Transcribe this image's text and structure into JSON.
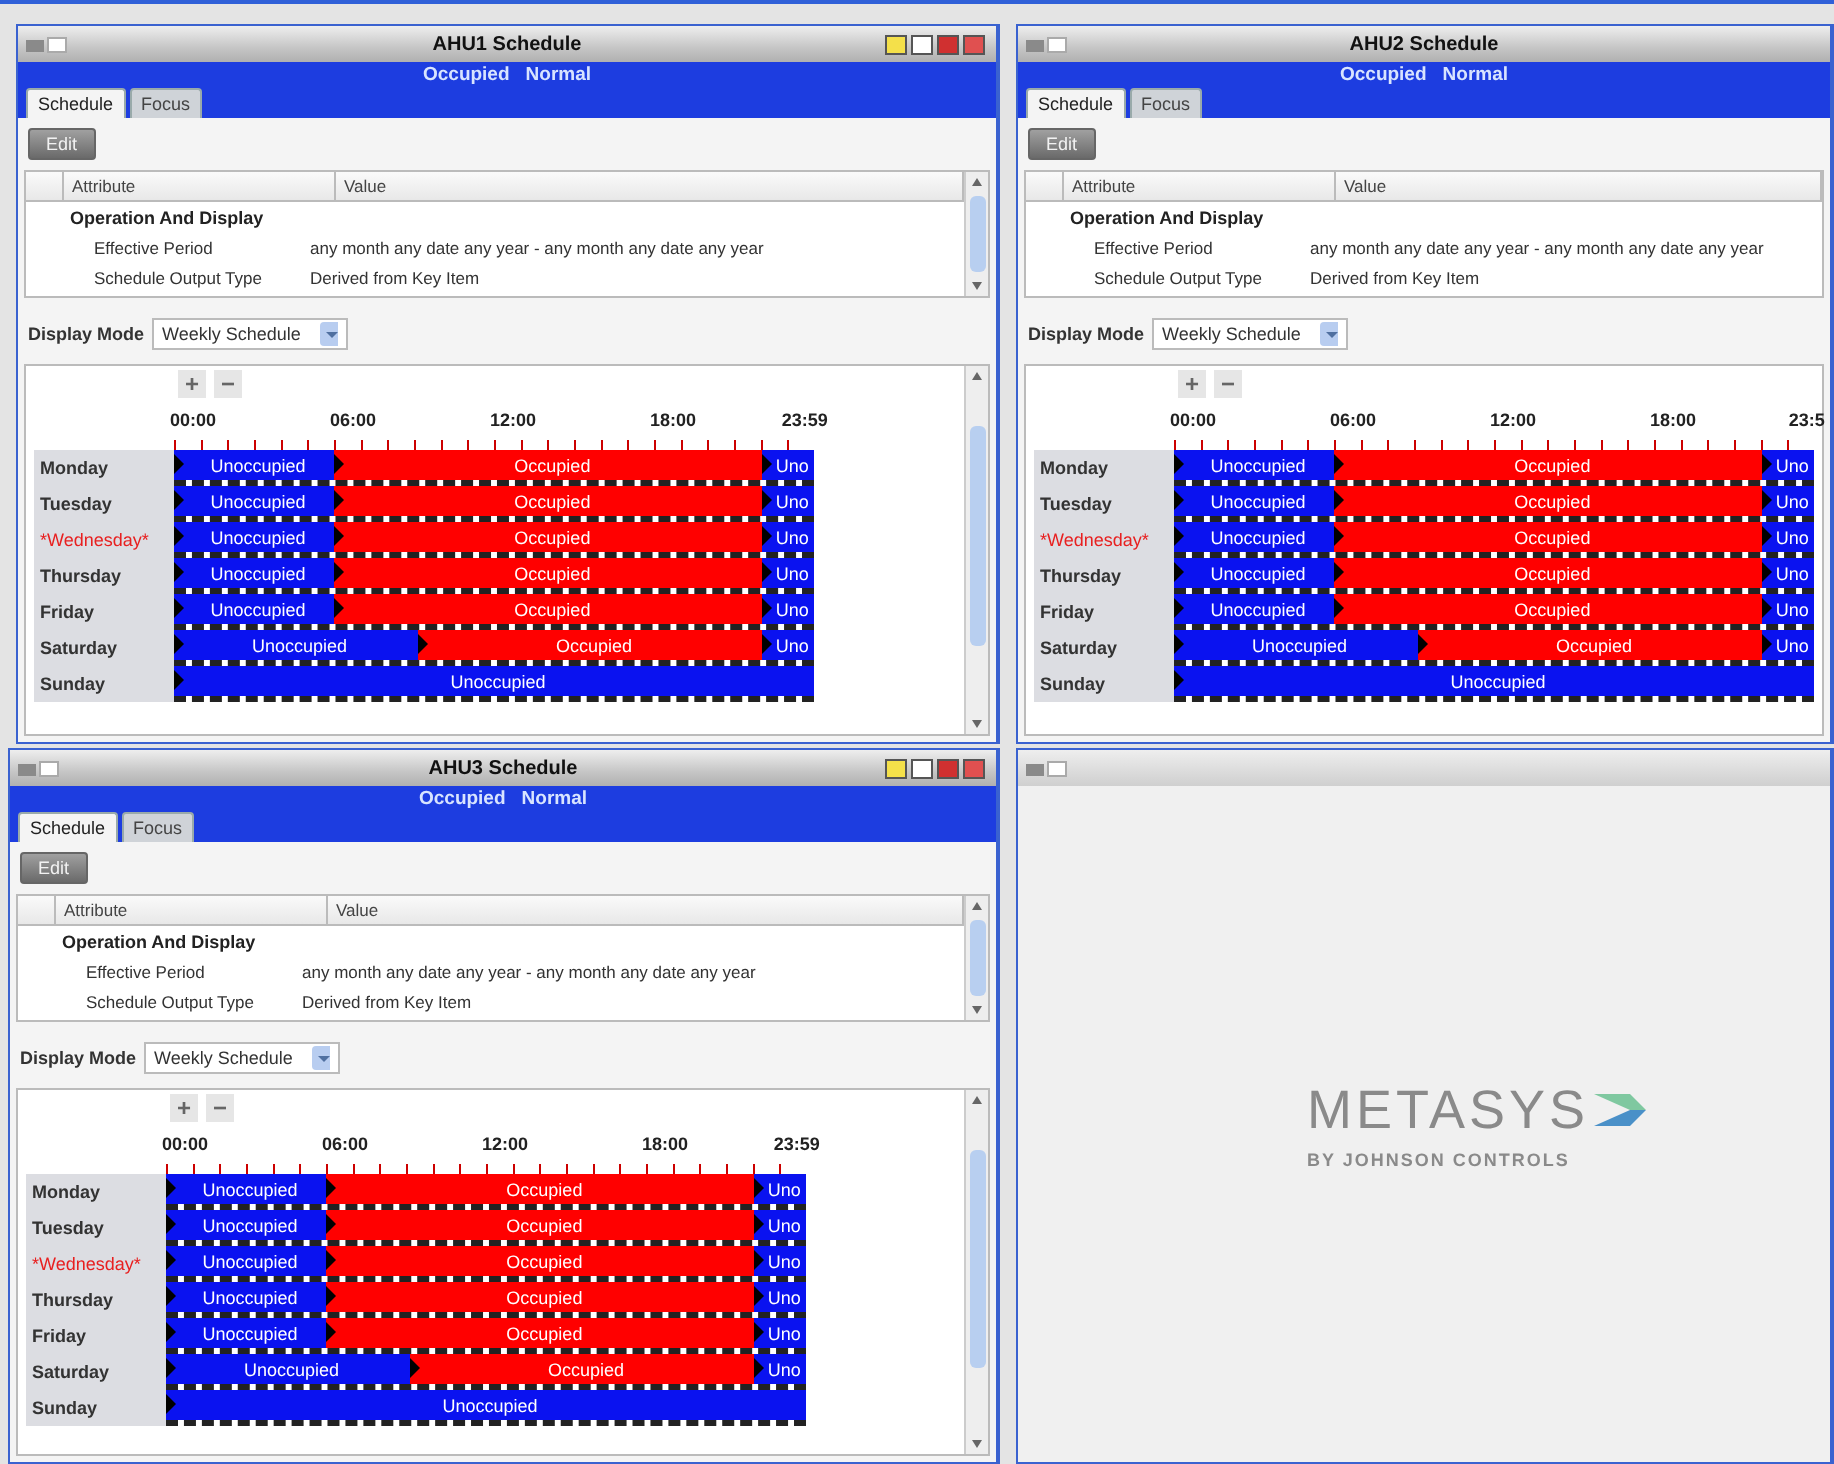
{
  "panels": [
    {
      "title": "AHU1 Schedule",
      "right_edge_hidden": false,
      "status": [
        "Occupied",
        "Normal"
      ],
      "tabs": [
        {
          "label": "Schedule",
          "selected": true
        },
        {
          "label": "Focus",
          "selected": false
        }
      ],
      "edit_button": {
        "label": "Edit",
        "disabled": true
      },
      "attributes": {
        "columns": [
          "Attribute",
          "Value"
        ],
        "group": "Operation And Display",
        "rows": [
          {
            "attribute": "Effective Period",
            "value": "any month any date any year  -  any month any date any year"
          },
          {
            "attribute": "Schedule Output Type",
            "value": "Derived from Key Item"
          }
        ]
      },
      "display_mode": {
        "label": "Display Mode",
        "value": "Weekly Schedule"
      },
      "schedule": {
        "zoom_in": "+",
        "zoom_out": "−",
        "times": [
          "00:00",
          "06:00",
          "12:00",
          "18:00",
          "23:59"
        ],
        "days": [
          {
            "name": "Monday",
            "today": false,
            "segments": [
              {
                "kind": "unoccupied",
                "label": "Unoccupied"
              },
              {
                "kind": "occupied",
                "label": "Occupied"
              },
              {
                "kind": "unoccupied",
                "label": "Uno"
              }
            ]
          },
          {
            "name": "Tuesday",
            "today": false,
            "segments": [
              {
                "kind": "unoccupied",
                "label": "Unoccupied"
              },
              {
                "kind": "occupied",
                "label": "Occupied"
              },
              {
                "kind": "unoccupied",
                "label": "Uno"
              }
            ]
          },
          {
            "name": "*Wednesday*",
            "today": true,
            "segments": [
              {
                "kind": "unoccupied",
                "label": "Unoccupied"
              },
              {
                "kind": "occupied",
                "label": "Occupied"
              },
              {
                "kind": "unoccupied",
                "label": "Uno"
              }
            ]
          },
          {
            "name": "Thursday",
            "today": false,
            "segments": [
              {
                "kind": "unoccupied",
                "label": "Unoccupied"
              },
              {
                "kind": "occupied",
                "label": "Occupied"
              },
              {
                "kind": "unoccupied",
                "label": "Uno"
              }
            ]
          },
          {
            "name": "Friday",
            "today": false,
            "segments": [
              {
                "kind": "unoccupied",
                "label": "Unoccupied"
              },
              {
                "kind": "occupied",
                "label": "Occupied"
              },
              {
                "kind": "unoccupied",
                "label": "Uno"
              }
            ]
          },
          {
            "name": "Saturday",
            "today": false,
            "segments": [
              {
                "kind": "unoccupied",
                "label": "Unoccupied"
              },
              {
                "kind": "occupied",
                "label": "Occupied"
              },
              {
                "kind": "unoccupied",
                "label": "Uno"
              }
            ]
          },
          {
            "name": "Sunday",
            "today": false,
            "segments": [
              {
                "kind": "unoccupied",
                "label": "Unoccupied"
              }
            ]
          }
        ]
      }
    },
    {
      "title": "AHU2 Schedule",
      "right_edge_hidden": true,
      "status": [
        "Occupied",
        "Normal"
      ],
      "tabs": [
        {
          "label": "Schedule",
          "selected": true
        },
        {
          "label": "Focus",
          "selected": false
        }
      ],
      "edit_button": {
        "label": "Edit",
        "disabled": true
      },
      "attributes": {
        "columns": [
          "Attribute",
          "Value"
        ],
        "group": "Operation And Display",
        "rows": [
          {
            "attribute": "Effective Period",
            "value": "any month any date any year  -  any month any date any year"
          },
          {
            "attribute": "Schedule Output Type",
            "value": "Derived from Key Item"
          }
        ]
      },
      "display_mode": {
        "label": "Display Mode",
        "value": "Weekly Schedule"
      },
      "schedule": {
        "zoom_in": "+",
        "zoom_out": "−",
        "times": [
          "00:00",
          "06:00",
          "12:00",
          "18:00",
          "23:5"
        ],
        "days": [
          {
            "name": "Monday",
            "today": false,
            "segments": [
              {
                "kind": "unoccupied",
                "label": "Unoccupied"
              },
              {
                "kind": "occupied",
                "label": "Occupied"
              },
              {
                "kind": "unoccupied",
                "label": "Uno"
              }
            ]
          },
          {
            "name": "Tuesday",
            "today": false,
            "segments": [
              {
                "kind": "unoccupied",
                "label": "Unoccupied"
              },
              {
                "kind": "occupied",
                "label": "Occupied"
              },
              {
                "kind": "unoccupied",
                "label": "Uno"
              }
            ]
          },
          {
            "name": "*Wednesday*",
            "today": true,
            "segments": [
              {
                "kind": "unoccupied",
                "label": "Unoccupied"
              },
              {
                "kind": "occupied",
                "label": "Occupied"
              },
              {
                "kind": "unoccupied",
                "label": "Uno"
              }
            ]
          },
          {
            "name": "Thursday",
            "today": false,
            "segments": [
              {
                "kind": "unoccupied",
                "label": "Unoccupied"
              },
              {
                "kind": "occupied",
                "label": "Occupied"
              },
              {
                "kind": "unoccupied",
                "label": "Uno"
              }
            ]
          },
          {
            "name": "Friday",
            "today": false,
            "segments": [
              {
                "kind": "unoccupied",
                "label": "Unoccupied"
              },
              {
                "kind": "occupied",
                "label": "Occupied"
              },
              {
                "kind": "unoccupied",
                "label": "Uno"
              }
            ]
          },
          {
            "name": "Saturday",
            "today": false,
            "segments": [
              {
                "kind": "unoccupied",
                "label": "Unoccupied"
              },
              {
                "kind": "occupied",
                "label": "Occupied"
              },
              {
                "kind": "unoccupied",
                "label": "Uno"
              }
            ]
          },
          {
            "name": "Sunday",
            "today": false,
            "segments": [
              {
                "kind": "unoccupied",
                "label": "Unoccupied"
              }
            ]
          }
        ]
      }
    },
    {
      "title": "AHU3 Schedule",
      "right_edge_hidden": false,
      "status": [
        "Occupied",
        "Normal"
      ],
      "tabs": [
        {
          "label": "Schedule",
          "selected": true
        },
        {
          "label": "Focus",
          "selected": false
        }
      ],
      "edit_button": {
        "label": "Edit",
        "disabled": true
      },
      "attributes": {
        "columns": [
          "Attribute",
          "Value"
        ],
        "group": "Operation And Display",
        "rows": [
          {
            "attribute": "Effective Period",
            "value": "any month any date any year  -  any month any date any year"
          },
          {
            "attribute": "Schedule Output Type",
            "value": "Derived from Key Item"
          }
        ]
      },
      "display_mode": {
        "label": "Display Mode",
        "value": "Weekly Schedule"
      },
      "schedule": {
        "zoom_in": "+",
        "zoom_out": "−",
        "times": [
          "00:00",
          "06:00",
          "12:00",
          "18:00",
          "23:59"
        ],
        "days": [
          {
            "name": "Monday",
            "today": false,
            "segments": [
              {
                "kind": "unoccupied",
                "label": "Unoccupied"
              },
              {
                "kind": "occupied",
                "label": "Occupied"
              },
              {
                "kind": "unoccupied",
                "label": "Uno"
              }
            ]
          },
          {
            "name": "Tuesday",
            "today": false,
            "segments": [
              {
                "kind": "unoccupied",
                "label": "Unoccupied"
              },
              {
                "kind": "occupied",
                "label": "Occupied"
              },
              {
                "kind": "unoccupied",
                "label": "Uno"
              }
            ]
          },
          {
            "name": "*Wednesday*",
            "today": true,
            "segments": [
              {
                "kind": "unoccupied",
                "label": "Unoccupied"
              },
              {
                "kind": "occupied",
                "label": "Occupied"
              },
              {
                "kind": "unoccupied",
                "label": "Uno"
              }
            ]
          },
          {
            "name": "Thursday",
            "today": false,
            "segments": [
              {
                "kind": "unoccupied",
                "label": "Unoccupied"
              },
              {
                "kind": "occupied",
                "label": "Occupied"
              },
              {
                "kind": "unoccupied",
                "label": "Uno"
              }
            ]
          },
          {
            "name": "Friday",
            "today": false,
            "segments": [
              {
                "kind": "unoccupied",
                "label": "Unoccupied"
              },
              {
                "kind": "occupied",
                "label": "Occupied"
              },
              {
                "kind": "unoccupied",
                "label": "Uno"
              }
            ]
          },
          {
            "name": "Saturday",
            "today": false,
            "segments": [
              {
                "kind": "unoccupied",
                "label": "Unoccupied"
              },
              {
                "kind": "occupied",
                "label": "Occupied"
              },
              {
                "kind": "unoccupied",
                "label": "Uno"
              }
            ]
          },
          {
            "name": "Sunday",
            "today": false,
            "segments": [
              {
                "kind": "unoccupied",
                "label": "Unoccupied"
              }
            ]
          }
        ]
      }
    }
  ],
  "logo_window": {
    "logo": "METASYS",
    "tagline": "BY JOHNSON CONTROLS"
  }
}
